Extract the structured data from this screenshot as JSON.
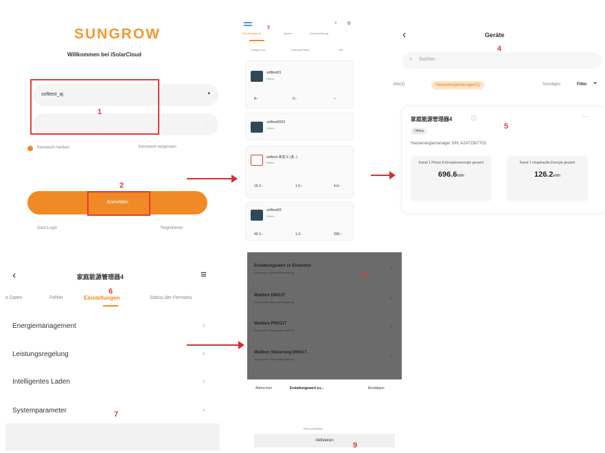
{
  "login": {
    "logo": "SUNGROW",
    "welcome": "Willkommen bei iSolarCloud",
    "username_value": "softtest_aj",
    "dropdown_glyph": "▾",
    "password_toggle": "···",
    "remember_label": "Kennwort merken",
    "forgot_label": "Kennwort vergessen",
    "login_button": "Anmelden",
    "guest_login": "Gast-Login",
    "register": "Registrieren",
    "step1": "1",
    "step2": "2"
  },
  "plant_list": {
    "tabs": [
      "Alle Anlagen(4)",
      "Alarme",
      "Systemleistung"
    ],
    "filters": [
      "Anlagen/Ort",
      "Sortieren/Filtern",
      "Alle"
    ],
    "cards": [
      {
        "name": "softtest01",
        "status": "Online",
        "values": [
          "8--",
          "0--",
          "--"
        ]
      },
      {
        "name": "softtest0202",
        "status": "Online",
        "values": []
      },
      {
        "name": "softtest 未定义 (多..)",
        "status": "Online",
        "values": [
          "15.2--",
          "1.5--",
          "4.0--"
        ]
      },
      {
        "name": "softtest03",
        "status": "Online",
        "values": [
          "40.1--",
          "1.3--",
          "200--"
        ]
      }
    ],
    "step3": "3"
  },
  "devices": {
    "back": "‹",
    "title": "Geräte",
    "search_placeholder": "Suchen",
    "filter_left": "Alle(3)",
    "active_chip": "Hausenergiemanager(1)",
    "filter_right": "Sonstiges",
    "filter_label": "Filter",
    "device_name": "家庭能源管理器4",
    "device_status": "Offline",
    "device_sn": "Hausenergiemanager S/N: A2472307703",
    "more": "···",
    "metric1_label": "Kanal 1 Phase A Einspeiseenergie gesamt",
    "metric1_value": "696.6",
    "metric1_unit": "kWh",
    "metric2_label": "Kanal 1 eingekaufte Energie gesamt",
    "metric2_value": "126.2",
    "metric2_unit": "kWh",
    "step4": "4",
    "step5": "5"
  },
  "settings": {
    "back": "‹",
    "title": "家庭能源管理器4",
    "menu_icon": "≡",
    "tabs": [
      "e Daten",
      "Fehler",
      "Einstellungen",
      "Status der Fernsteu"
    ],
    "rows": [
      "Energiemanagement",
      "Leistungsregelung",
      "Intelligentes Laden",
      "Systemparameter"
    ],
    "chevron": "›",
    "step6": "6",
    "step7": "7"
  },
  "dropdown": {
    "items": [
      {
        "title": "Erstattungswert zu Erkennen",
        "sub": "Gekoppelte Ladepunktsregelung"
      },
      {
        "title": "Wallbox DMG1T",
        "sub": "Gekoppelte Ladepunktsregelung"
      },
      {
        "title": "Wallbox PRO11T",
        "sub": "Gekoppelte Ladepunktsregelung"
      },
      {
        "title": "Wallbox Steuerung DMG1T",
        "sub": "Gekoppelte Ladepunktsregelung"
      }
    ],
    "chevron": "›",
    "bottom_tabs": [
      "Abbrechen",
      "Erstattungswert zu...",
      "Bestätigen"
    ],
    "hint": "Bitte auswählen",
    "activate_button": "Aktivieren",
    "step8": "8",
    "step9": "9"
  },
  "colors": {
    "accent": "#f08a24",
    "step_red": "#e53935",
    "arrow_red": "#d32f2f"
  }
}
